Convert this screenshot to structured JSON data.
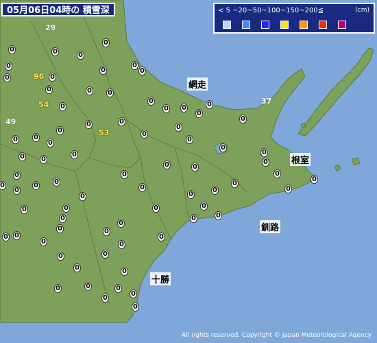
{
  "title": "05月06日04時の 積雪深",
  "legend": {
    "range_text": "< 5 ~20~50~100~150~200≦",
    "unit": "(cm)",
    "colors": [
      "#b4d8ff",
      "#3c8cff",
      "#1e28ff",
      "#ffe600",
      "#ff9600",
      "#ff2800",
      "#b4006e"
    ]
  },
  "land_color": "#7da05a",
  "sea_color": "#7fa7da",
  "places": {
    "abashiri": "網走",
    "nemuro": "根室",
    "kushiro": "釧路",
    "tokachi": "十勝"
  },
  "routes": {
    "r29": "29",
    "r49": "49",
    "r37": "37"
  },
  "yellow_labels": {
    "y96": "96",
    "y54": "54",
    "y53": "53"
  },
  "zero_value": "0",
  "copyright": "All rights reserved. Copyright © Japan Meteorological Agency"
}
